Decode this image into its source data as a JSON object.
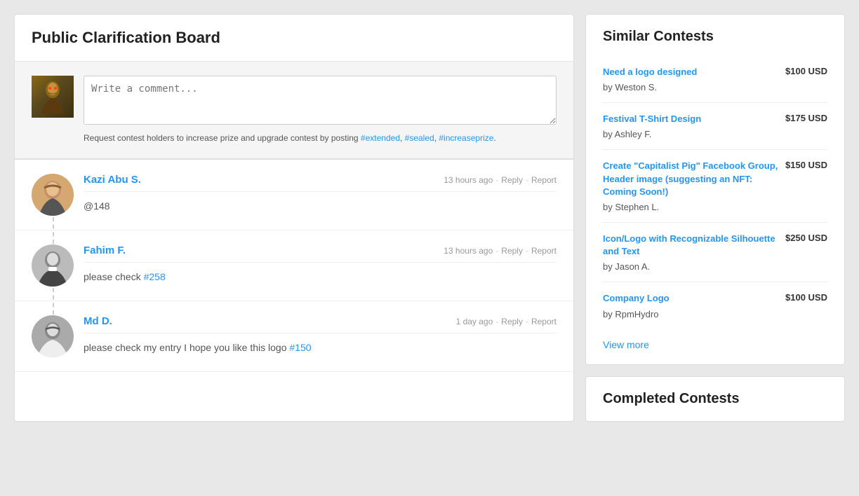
{
  "leftPanel": {
    "title": "Public Clarification Board",
    "commentArea": {
      "placeholder": "Write a comment...",
      "note": "Request contest holders to increase prize and upgrade contest by posting ",
      "tags": [
        "#extended",
        "#sealed",
        "#increaseprize"
      ]
    },
    "comments": [
      {
        "id": 1,
        "author": "Kazi Abu S.",
        "timeAgo": "13 hours ago",
        "replyLabel": "Reply",
        "reportLabel": "Report",
        "text": "@148",
        "avatarColor": "#c9a070"
      },
      {
        "id": 2,
        "author": "Fahim F.",
        "timeAgo": "13 hours ago",
        "replyLabel": "Reply",
        "reportLabel": "Report",
        "textPrefix": "please check ",
        "textLink": "#258",
        "avatarColor": "#888"
      },
      {
        "id": 3,
        "author": "Md D.",
        "timeAgo": "1 day ago",
        "replyLabel": "Reply",
        "reportLabel": "Report",
        "textPrefix": "please check my entry I hope you like this logo ",
        "textLink": "#150",
        "avatarColor": "#777"
      }
    ]
  },
  "rightPanel": {
    "similarContests": {
      "title": "Similar Contests",
      "items": [
        {
          "title": "Need a logo designed",
          "by": "by Weston S.",
          "price": "$100 USD"
        },
        {
          "title": "Festival T-Shirt Design",
          "by": "by Ashley F.",
          "price": "$175 USD"
        },
        {
          "title": "Create \"Capitalist Pig\" Facebook Group, Header image (suggesting an NFT: Coming Soon!)",
          "by": "by Stephen L.",
          "price": "$150 USD"
        },
        {
          "title": "Icon/Logo with Recognizable Silhouette and Text",
          "by": "by Jason A.",
          "price": "$250 USD"
        },
        {
          "title": "Company Logo",
          "by": "by RpmHydro",
          "price": "$100 USD"
        }
      ],
      "viewMore": "View more"
    },
    "completedContests": {
      "title": "Completed Contests"
    }
  }
}
